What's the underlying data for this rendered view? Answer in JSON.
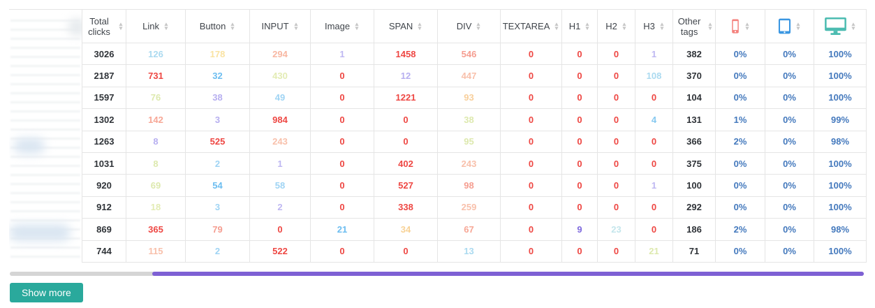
{
  "table": {
    "columns": [
      {
        "key": "total",
        "label": "Total clicks"
      },
      {
        "key": "link",
        "label": "Link"
      },
      {
        "key": "button",
        "label": "Button"
      },
      {
        "key": "input",
        "label": "INPUT"
      },
      {
        "key": "image",
        "label": "Image"
      },
      {
        "key": "span",
        "label": "SPAN"
      },
      {
        "key": "div",
        "label": "DIV"
      },
      {
        "key": "textarea",
        "label": "TEXTAREA"
      },
      {
        "key": "h1",
        "label": "H1"
      },
      {
        "key": "h2",
        "label": "H2"
      },
      {
        "key": "h3",
        "label": "H3"
      },
      {
        "key": "other",
        "label": "Other tags"
      },
      {
        "key": "mobile",
        "icon": "mobile-icon",
        "color": "#f4827e"
      },
      {
        "key": "tablet",
        "icon": "tablet-icon",
        "color": "#3b97e2"
      },
      {
        "key": "desktop",
        "icon": "desktop-icon",
        "color": "#4cbcb1"
      }
    ],
    "rows": [
      {
        "cells": [
          {
            "v": "3026",
            "c": "#2f3338"
          },
          {
            "v": "126",
            "c": "#abdaf0"
          },
          {
            "v": "178",
            "c": "#fae3a2"
          },
          {
            "v": "294",
            "c": "#f8b7a2"
          },
          {
            "v": "1",
            "c": "#beb7f2"
          },
          {
            "v": "1458",
            "c": "#ee4743"
          },
          {
            "v": "546",
            "c": "#f59d90"
          },
          {
            "v": "0",
            "c": "#ee4743"
          },
          {
            "v": "0",
            "c": "#ee4743"
          },
          {
            "v": "0",
            "c": "#ee4743"
          },
          {
            "v": "1",
            "c": "#beb7f2"
          },
          {
            "v": "382",
            "c": "#2f3338"
          },
          {
            "v": "0%",
            "c": "#4479bd"
          },
          {
            "v": "0%",
            "c": "#4479bd"
          },
          {
            "v": "100%",
            "c": "#4479bd"
          }
        ]
      },
      {
        "cells": [
          {
            "v": "2187",
            "c": "#2f3338"
          },
          {
            "v": "731",
            "c": "#ee4743"
          },
          {
            "v": "32",
            "c": "#6cbdf0"
          },
          {
            "v": "430",
            "c": "#e3ecb4"
          },
          {
            "v": "0",
            "c": "#ee4743"
          },
          {
            "v": "12",
            "c": "#b7aff0"
          },
          {
            "v": "447",
            "c": "#f8c0ab"
          },
          {
            "v": "0",
            "c": "#ee4743"
          },
          {
            "v": "0",
            "c": "#ee4743"
          },
          {
            "v": "0",
            "c": "#ee4743"
          },
          {
            "v": "108",
            "c": "#abdaf0"
          },
          {
            "v": "370",
            "c": "#2f3338"
          },
          {
            "v": "0%",
            "c": "#4479bd"
          },
          {
            "v": "0%",
            "c": "#4479bd"
          },
          {
            "v": "100%",
            "c": "#4479bd"
          }
        ]
      },
      {
        "cells": [
          {
            "v": "1597",
            "c": "#2f3338"
          },
          {
            "v": "76",
            "c": "#dde9ae"
          },
          {
            "v": "38",
            "c": "#b7aff0"
          },
          {
            "v": "49",
            "c": "#9fd4f4"
          },
          {
            "v": "0",
            "c": "#ee4743"
          },
          {
            "v": "1221",
            "c": "#ee4743"
          },
          {
            "v": "93",
            "c": "#f8cf9b"
          },
          {
            "v": "0",
            "c": "#ee4743"
          },
          {
            "v": "0",
            "c": "#ee4743"
          },
          {
            "v": "0",
            "c": "#ee4743"
          },
          {
            "v": "0",
            "c": "#ee4743"
          },
          {
            "v": "104",
            "c": "#2f3338"
          },
          {
            "v": "0%",
            "c": "#4479bd"
          },
          {
            "v": "0%",
            "c": "#4479bd"
          },
          {
            "v": "100%",
            "c": "#4479bd"
          }
        ]
      },
      {
        "cells": [
          {
            "v": "1302",
            "c": "#2f3338"
          },
          {
            "v": "142",
            "c": "#f7a796"
          },
          {
            "v": "3",
            "c": "#b7aff0"
          },
          {
            "v": "984",
            "c": "#ee4743"
          },
          {
            "v": "0",
            "c": "#ee4743"
          },
          {
            "v": "0",
            "c": "#ee4743"
          },
          {
            "v": "38",
            "c": "#dde9ae"
          },
          {
            "v": "0",
            "c": "#ee4743"
          },
          {
            "v": "0",
            "c": "#ee4743"
          },
          {
            "v": "0",
            "c": "#ee4743"
          },
          {
            "v": "4",
            "c": "#85c8f0"
          },
          {
            "v": "131",
            "c": "#2f3338"
          },
          {
            "v": "1%",
            "c": "#4479bd"
          },
          {
            "v": "0%",
            "c": "#4479bd"
          },
          {
            "v": "99%",
            "c": "#4479bd"
          }
        ]
      },
      {
        "cells": [
          {
            "v": "1263",
            "c": "#2f3338"
          },
          {
            "v": "8",
            "c": "#b7aff0"
          },
          {
            "v": "525",
            "c": "#ee4743"
          },
          {
            "v": "243",
            "c": "#f8c0ab"
          },
          {
            "v": "0",
            "c": "#ee4743"
          },
          {
            "v": "0",
            "c": "#ee4743"
          },
          {
            "v": "95",
            "c": "#dde9ae"
          },
          {
            "v": "0",
            "c": "#ee4743"
          },
          {
            "v": "0",
            "c": "#ee4743"
          },
          {
            "v": "0",
            "c": "#ee4743"
          },
          {
            "v": "0",
            "c": "#ee4743"
          },
          {
            "v": "366",
            "c": "#2f3338"
          },
          {
            "v": "2%",
            "c": "#4479bd"
          },
          {
            "v": "0%",
            "c": "#4479bd"
          },
          {
            "v": "98%",
            "c": "#4479bd"
          }
        ]
      },
      {
        "cells": [
          {
            "v": "1031",
            "c": "#2f3338"
          },
          {
            "v": "8",
            "c": "#dde9ae"
          },
          {
            "v": "2",
            "c": "#9fd4f4"
          },
          {
            "v": "1",
            "c": "#beb7f2"
          },
          {
            "v": "0",
            "c": "#ee4743"
          },
          {
            "v": "402",
            "c": "#ee4743"
          },
          {
            "v": "243",
            "c": "#f8c0ab"
          },
          {
            "v": "0",
            "c": "#ee4743"
          },
          {
            "v": "0",
            "c": "#ee4743"
          },
          {
            "v": "0",
            "c": "#ee4743"
          },
          {
            "v": "0",
            "c": "#ee4743"
          },
          {
            "v": "375",
            "c": "#2f3338"
          },
          {
            "v": "0%",
            "c": "#4479bd"
          },
          {
            "v": "0%",
            "c": "#4479bd"
          },
          {
            "v": "100%",
            "c": "#4479bd"
          }
        ]
      },
      {
        "cells": [
          {
            "v": "920",
            "c": "#2f3338"
          },
          {
            "v": "69",
            "c": "#dde9ae"
          },
          {
            "v": "54",
            "c": "#6cbdf0"
          },
          {
            "v": "58",
            "c": "#9fd4f4"
          },
          {
            "v": "0",
            "c": "#ee4743"
          },
          {
            "v": "527",
            "c": "#ee4743"
          },
          {
            "v": "98",
            "c": "#f59d90"
          },
          {
            "v": "0",
            "c": "#ee4743"
          },
          {
            "v": "0",
            "c": "#ee4743"
          },
          {
            "v": "0",
            "c": "#ee4743"
          },
          {
            "v": "1",
            "c": "#beb7f2"
          },
          {
            "v": "100",
            "c": "#2f3338"
          },
          {
            "v": "0%",
            "c": "#4479bd"
          },
          {
            "v": "0%",
            "c": "#4479bd"
          },
          {
            "v": "100%",
            "c": "#4479bd"
          }
        ]
      },
      {
        "cells": [
          {
            "v": "912",
            "c": "#2f3338"
          },
          {
            "v": "18",
            "c": "#e3ecb4"
          },
          {
            "v": "3",
            "c": "#9fd4f4"
          },
          {
            "v": "2",
            "c": "#beb7f2"
          },
          {
            "v": "0",
            "c": "#ee4743"
          },
          {
            "v": "338",
            "c": "#ee4743"
          },
          {
            "v": "259",
            "c": "#f8c0ab"
          },
          {
            "v": "0",
            "c": "#ee4743"
          },
          {
            "v": "0",
            "c": "#ee4743"
          },
          {
            "v": "0",
            "c": "#ee4743"
          },
          {
            "v": "0",
            "c": "#ee4743"
          },
          {
            "v": "292",
            "c": "#2f3338"
          },
          {
            "v": "0%",
            "c": "#4479bd"
          },
          {
            "v": "0%",
            "c": "#4479bd"
          },
          {
            "v": "100%",
            "c": "#4479bd"
          }
        ]
      },
      {
        "cells": [
          {
            "v": "869",
            "c": "#2f3338"
          },
          {
            "v": "365",
            "c": "#ee4743"
          },
          {
            "v": "79",
            "c": "#f59d90"
          },
          {
            "v": "0",
            "c": "#ee4743"
          },
          {
            "v": "21",
            "c": "#6cbdf0"
          },
          {
            "v": "34",
            "c": "#f8d296"
          },
          {
            "v": "67",
            "c": "#f7a796"
          },
          {
            "v": "0",
            "c": "#ee4743"
          },
          {
            "v": "9",
            "c": "#7f6ade"
          },
          {
            "v": "23",
            "c": "#c4e6ec"
          },
          {
            "v": "0",
            "c": "#ee4743"
          },
          {
            "v": "186",
            "c": "#2f3338"
          },
          {
            "v": "2%",
            "c": "#4479bd"
          },
          {
            "v": "0%",
            "c": "#4479bd"
          },
          {
            "v": "98%",
            "c": "#4479bd"
          }
        ]
      },
      {
        "cells": [
          {
            "v": "744",
            "c": "#2f3338"
          },
          {
            "v": "115",
            "c": "#f8c0ab"
          },
          {
            "v": "2",
            "c": "#9fd4f4"
          },
          {
            "v": "522",
            "c": "#ee4743"
          },
          {
            "v": "0",
            "c": "#ee4743"
          },
          {
            "v": "0",
            "c": "#ee4743"
          },
          {
            "v": "13",
            "c": "#abdaf0"
          },
          {
            "v": "0",
            "c": "#ee4743"
          },
          {
            "v": "0",
            "c": "#ee4743"
          },
          {
            "v": "0",
            "c": "#ee4743"
          },
          {
            "v": "21",
            "c": "#dde9ae"
          },
          {
            "v": "71",
            "c": "#2f3338"
          },
          {
            "v": "0%",
            "c": "#4479bd"
          },
          {
            "v": "0%",
            "c": "#4479bd"
          },
          {
            "v": "100%",
            "c": "#4479bd"
          }
        ]
      }
    ]
  },
  "show_more_label": "Show more",
  "ui_colors": {
    "show_more_button": "#2aa99c",
    "scrollbar_thumb": "#7e60d4",
    "scrollbar_track": "#d5d5d5",
    "mobile_icon": "#f4827e",
    "tablet_icon": "#3b97e2",
    "desktop_icon": "#4cbcb1",
    "percent_text": "#4479bd",
    "highlight_red": "#ee4743"
  }
}
